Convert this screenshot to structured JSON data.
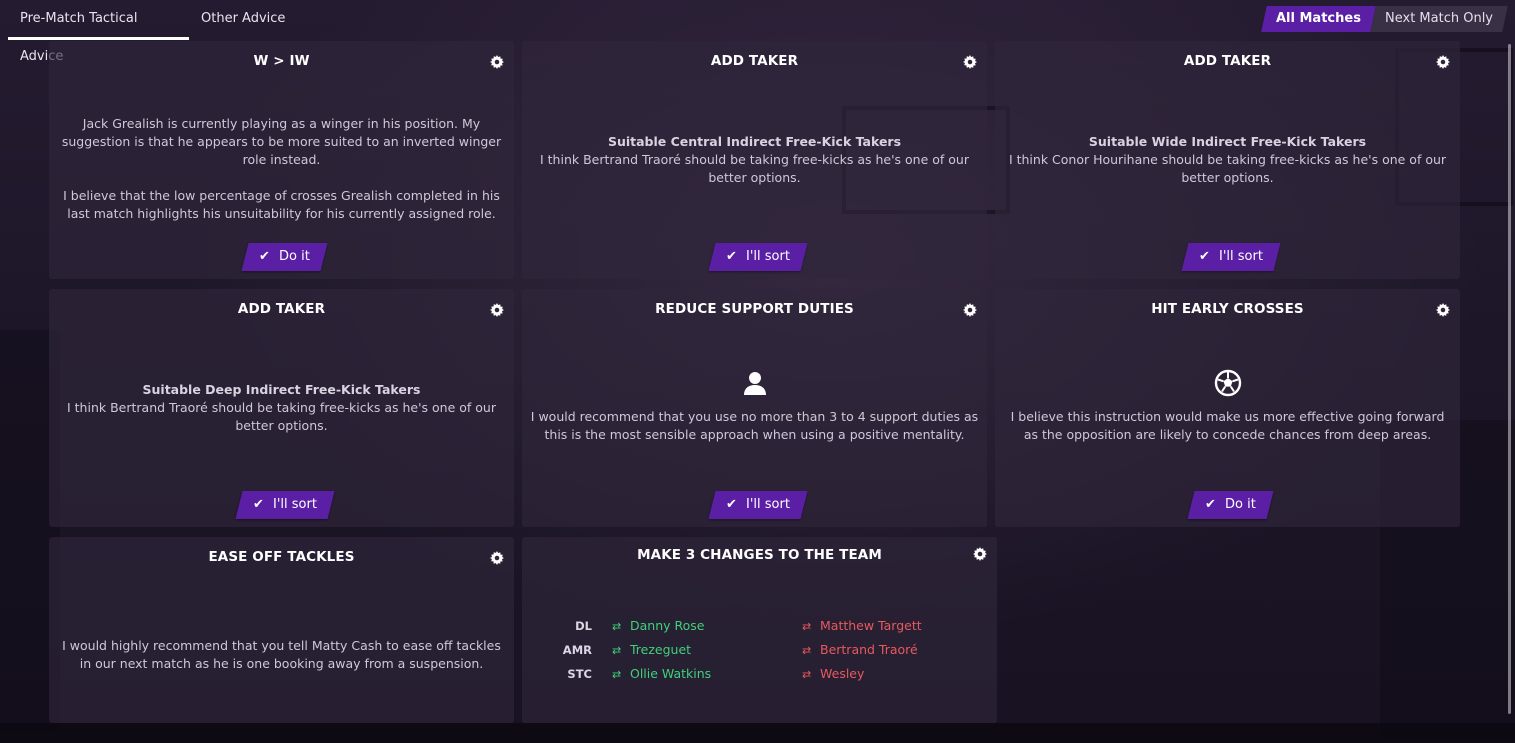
{
  "tabs": {
    "pre_match": "Pre-Match Tactical Advice",
    "other": "Other Advice"
  },
  "filter": {
    "all": "All Matches",
    "next": "Next Match Only"
  },
  "cards": {
    "c1": {
      "title": "W > IW",
      "p1": "Jack Grealish is currently playing as a winger in his position. My suggestion is that he appears to be more suited to an inverted winger role instead.",
      "p2": "I believe that the low percentage of crosses Grealish completed in his last match highlights his unsuitability for his currently assigned role.",
      "button": "Do it"
    },
    "c2": {
      "title": "ADD TAKER",
      "subtitle": "Suitable Central Indirect Free-Kick Takers",
      "text": "I think Bertrand Traoré should be taking free-kicks as he's one of our better options.",
      "button": "I'll sort"
    },
    "c3": {
      "title": "ADD TAKER",
      "subtitle": "Suitable Wide Indirect Free-Kick Takers",
      "text": "I think Conor Hourihane should be taking free-kicks as he's one of our better options.",
      "button": "I'll sort"
    },
    "c4": {
      "title": "ADD TAKER",
      "subtitle": "Suitable Deep Indirect Free-Kick Takers",
      "text": "I think Bertrand Traoré should be taking free-kicks as he's one of our better options.",
      "button": "I'll sort"
    },
    "c5": {
      "title": "REDUCE SUPPORT DUTIES",
      "icon": "person-icon",
      "text": "I would recommend that you use no more than 3 to 4 support duties as this is the most sensible approach when using a positive mentality.",
      "button": "I'll sort"
    },
    "c6": {
      "title": "HIT EARLY CROSSES",
      "icon": "football-icon",
      "text": "I believe this instruction would make us more effective going forward as the opposition are likely to concede chances from deep areas.",
      "button": "Do it"
    },
    "c7": {
      "title": "EASE OFF TACKLES",
      "text": "I would highly recommend that you tell Matty Cash to ease off tackles in our next match as he is one booking away from a suspension."
    },
    "c8": {
      "title": "MAKE 3 CHANGES TO THE TEAM",
      "changes": [
        {
          "pos": "DL",
          "in": "Danny Rose",
          "out": "Matthew Targett"
        },
        {
          "pos": "AMR",
          "in": "Trezeguet",
          "out": "Bertrand Traoré"
        },
        {
          "pos": "STC",
          "in": "Ollie Watkins",
          "out": "Wesley"
        }
      ]
    }
  },
  "colors": {
    "accent": "#5b1fa6",
    "player_in": "#3fd17a",
    "player_out": "#e8595e"
  }
}
